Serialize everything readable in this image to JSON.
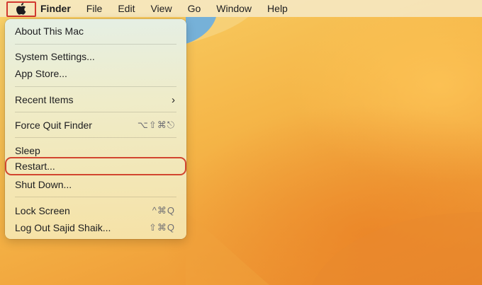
{
  "menubar": {
    "apple_icon": "apple-logo-icon",
    "app_name": "Finder",
    "items": [
      "File",
      "Edit",
      "View",
      "Go",
      "Window",
      "Help"
    ]
  },
  "apple_menu": {
    "about": "About This Mac",
    "system_settings": "System Settings...",
    "app_store": "App Store...",
    "recent_items": "Recent Items",
    "recent_items_arrow": "›",
    "force_quit": "Force Quit Finder",
    "force_quit_shortcut": "⌥⇧⌘⎋",
    "sleep": "Sleep",
    "restart": "Restart...",
    "shut_down": "Shut Down...",
    "lock_screen": "Lock Screen",
    "lock_screen_shortcut": "^⌘Q",
    "log_out": "Log Out Sajid Shaik...",
    "log_out_shortcut": "⇧⌘Q"
  },
  "colors": {
    "highlight_outline": "#d2452f",
    "apple_outline": "#d2392f"
  }
}
